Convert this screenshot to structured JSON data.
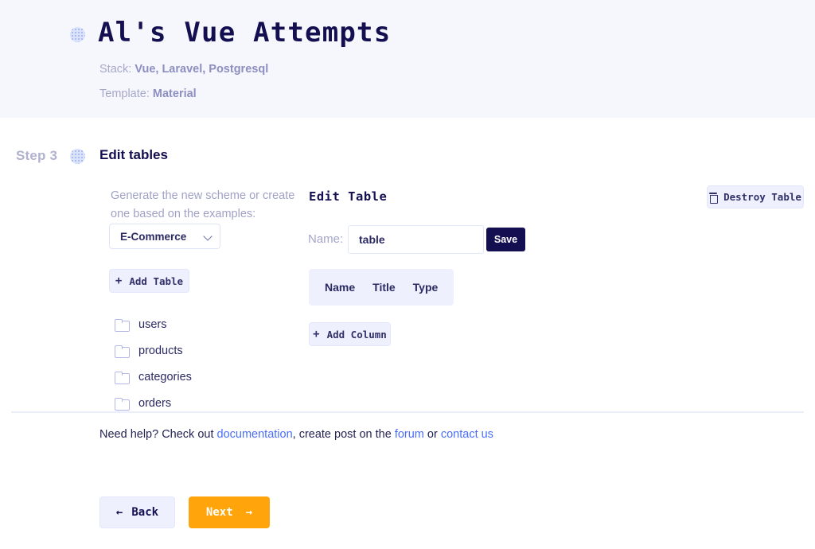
{
  "header": {
    "logo_icon": "dotted-circle-icon",
    "title": "Al's Vue Attempts",
    "stack_label": "Stack:",
    "stack_value": "Vue, Laravel, Postgresql",
    "template_label": "Template:",
    "template_value": "Material"
  },
  "step": {
    "label": "Step 3",
    "dot_icon": "dotted-circle-icon",
    "title": "Edit tables"
  },
  "left_panel": {
    "generate_text": "Generate the new scheme or create one based on the examples:",
    "select": {
      "value": "E-Commerce",
      "chevron_icon": "chevron-down-icon"
    },
    "add_table_label": "Add Table",
    "plus_icon": "+",
    "tables": [
      {
        "name": "users",
        "icon": "folder-icon"
      },
      {
        "name": "products",
        "icon": "folder-icon"
      },
      {
        "name": "categories",
        "icon": "folder-icon"
      },
      {
        "name": "orders",
        "icon": "folder-icon"
      }
    ]
  },
  "edit_panel": {
    "title": "Edit Table",
    "name_label": "Name:",
    "name_value": "table",
    "name_placeholder": "",
    "save_label": "Save",
    "columns_header": [
      "Name",
      "Title",
      "Type"
    ],
    "add_column_label": "Add Column",
    "plus_icon": "+"
  },
  "destroy": {
    "label": "Destroy Table",
    "icon": "trash-icon"
  },
  "help": {
    "prefix": "Need help? Check out ",
    "link_documentation": "documentation",
    "middle": ", create post on the ",
    "link_forum": "forum",
    "conjunction": " or ",
    "link_contact": "contact us"
  },
  "footer": {
    "back_label": "Back",
    "back_icon": "arrow-left-icon",
    "next_label": "Next",
    "next_icon": "arrow-right-icon"
  },
  "colors": {
    "header_bg": "#f6f7fd",
    "navy": "#130f50",
    "accent_orange": "#ffa40a",
    "link_blue": "#4a6dfb",
    "soft_blue": "#eef1fd"
  }
}
